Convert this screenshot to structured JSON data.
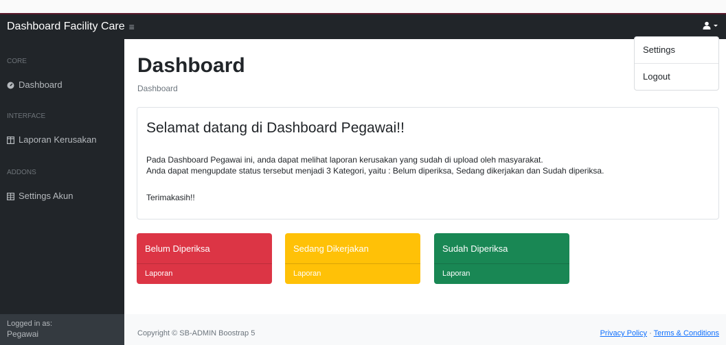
{
  "navbar": {
    "brand": "Dashboard Facility Care",
    "toggler_icon": "hamburger-menu-icon",
    "user_icon": "user-icon"
  },
  "user_dropdown": {
    "items": [
      {
        "label": "Settings"
      },
      {
        "label": "Logout"
      }
    ]
  },
  "sidebar": {
    "sections": [
      {
        "heading": "CORE",
        "items": [
          {
            "label": "Dashboard",
            "icon": "tachometer-icon"
          }
        ]
      },
      {
        "heading": "INTERFACE",
        "items": [
          {
            "label": "Laporan Kerusakan",
            "icon": "columns-icon"
          }
        ]
      },
      {
        "heading": "ADDONS",
        "items": [
          {
            "label": "Settings Akun",
            "icon": "table-icon"
          }
        ]
      }
    ],
    "footer": {
      "logged_in_label": "Logged in as:",
      "user_name": "Pegawai"
    }
  },
  "main": {
    "title": "Dashboard",
    "breadcrumb": "Dashboard",
    "welcome": {
      "title": "Selamat datang di Dashboard Pegawai!!",
      "line1": "Pada Dashboard Pegawai ini, anda dapat melihat laporan kerusakan yang sudah di upload oleh masyarakat.",
      "line2": "Anda dapat mengupdate status tersebut menjadi 3 Kategori, yaitu : Belum diperiksa, Sedang dikerjakan dan Sudah diperiksa.",
      "thanks": "Terimakasih!!"
    },
    "status_cards": [
      {
        "title": "Belum Diperiksa",
        "link": "Laporan",
        "color": "#dc3545"
      },
      {
        "title": "Sedang Dikerjakan",
        "link": "Laporan",
        "color": "#ffc107"
      },
      {
        "title": "Sudah Diperiksa",
        "link": "Laporan",
        "color": "#198754"
      }
    ]
  },
  "footer": {
    "copyright": "Copyright © SB-ADMIN Boostrap 5",
    "privacy": "Privacy Policy",
    "separator": "·",
    "terms": "Terms & Conditions"
  },
  "colors": {
    "navbar_bg": "#212529",
    "sidebar_footer_bg": "#343a40",
    "link_blue": "#0d6efd"
  }
}
